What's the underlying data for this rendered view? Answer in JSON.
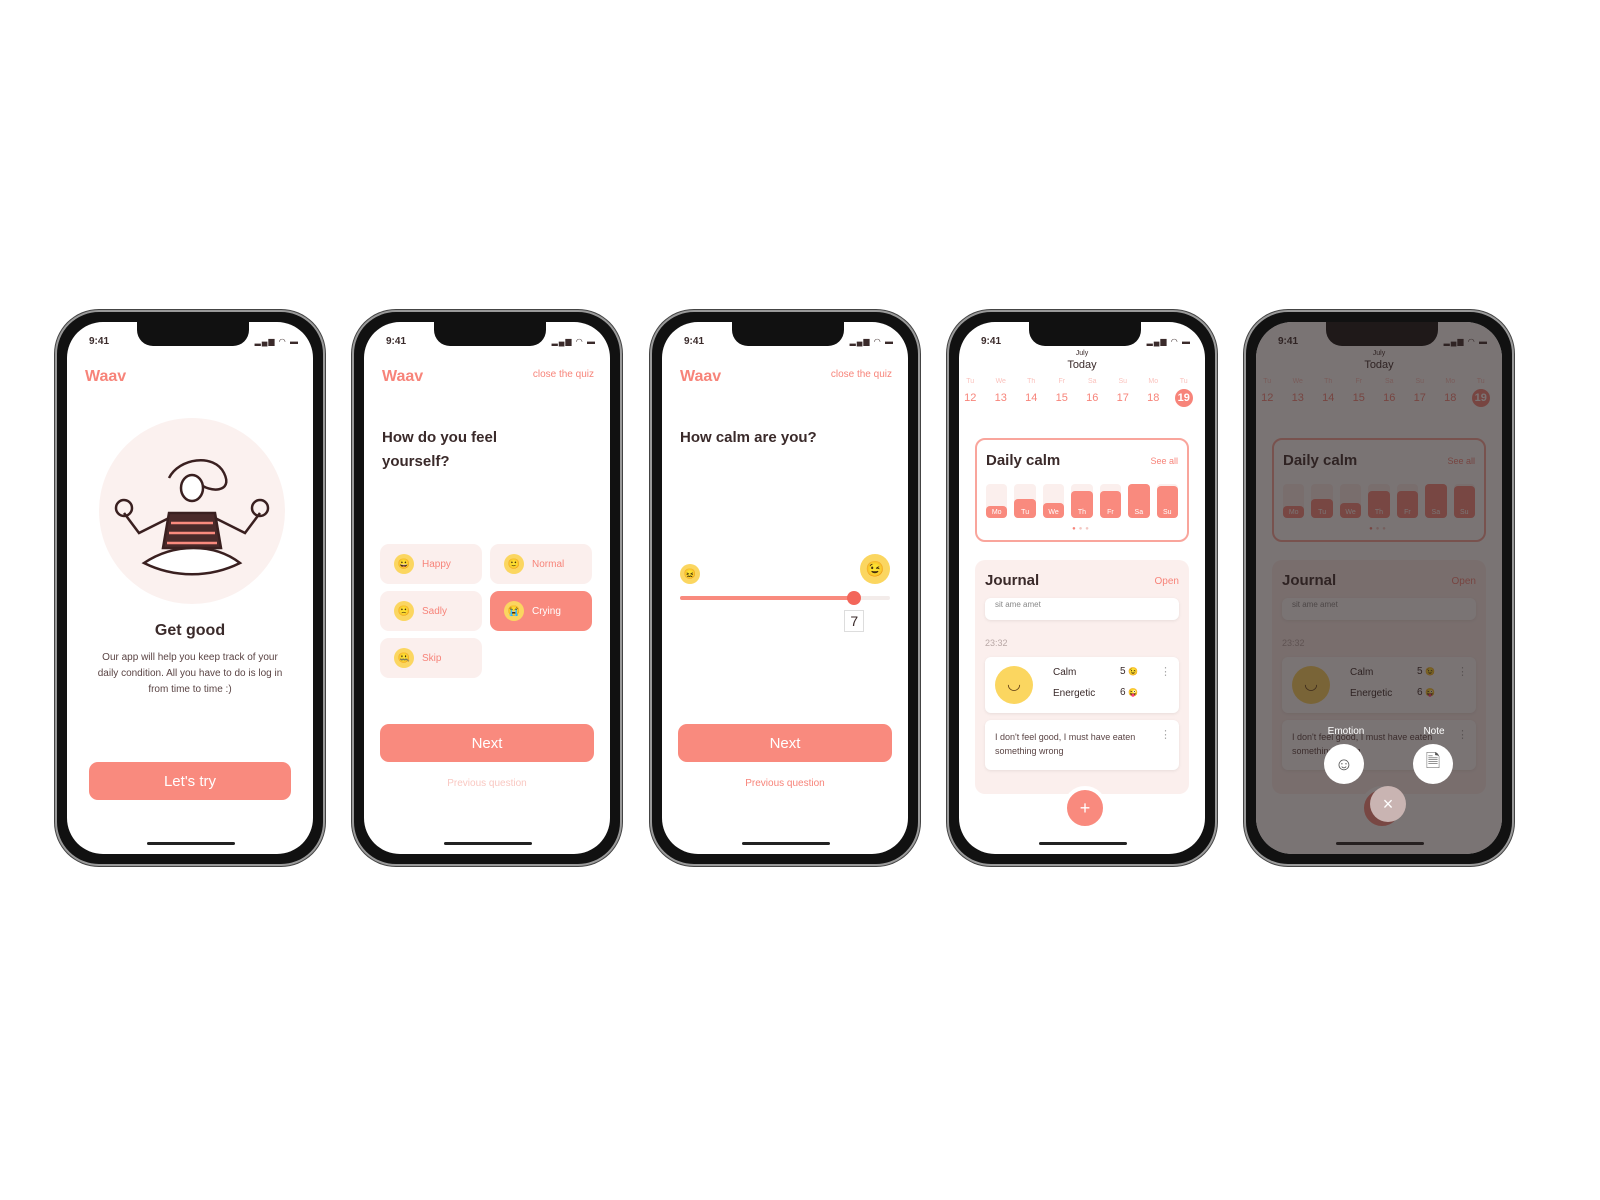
{
  "status": {
    "time": "9:41",
    "signal": "signal-icon",
    "wifi": "wifi-icon",
    "battery": "battery-icon"
  },
  "brand": {
    "logo": "Waav",
    "accent": "#f98a7e",
    "light": "#fbefed"
  },
  "s1": {
    "title": "Get good",
    "body": "Our app will help you keep track of your daily condition. All you have to do is log in from time to time :)",
    "button": "Let's try"
  },
  "s2": {
    "close": "close the quiz",
    "question": "How do you feel yourself?",
    "options": [
      {
        "label": "Happy",
        "emoji": "😀",
        "selected": false
      },
      {
        "label": "Normal",
        "emoji": "🙂",
        "selected": false
      },
      {
        "label": "Sadly",
        "emoji": "🙁",
        "selected": false
      },
      {
        "label": "Crying",
        "emoji": "😭",
        "selected": true
      },
      {
        "label": "Skip",
        "emoji": "🤐",
        "selected": false
      }
    ],
    "next": "Next",
    "previous": "Previous question"
  },
  "s3": {
    "close": "close the quiz",
    "question": "How calm are you?",
    "slider_value": "7",
    "slider_min_emoji": "😖",
    "slider_max_emoji": "😉",
    "slider_fraction": 0.83,
    "next": "Next",
    "previous": "Previous question"
  },
  "s4": {
    "month": "July",
    "today": "Today",
    "days": [
      {
        "w": "Tu",
        "d": "12"
      },
      {
        "w": "We",
        "d": "13"
      },
      {
        "w": "Th",
        "d": "14"
      },
      {
        "w": "Fr",
        "d": "15"
      },
      {
        "w": "Sa",
        "d": "16"
      },
      {
        "w": "Su",
        "d": "17"
      },
      {
        "w": "Mo",
        "d": "18"
      },
      {
        "w": "Tu",
        "d": "19"
      }
    ],
    "daily": {
      "title": "Daily calm",
      "see_all": "See all",
      "bars": [
        {
          "label": "Mo",
          "value": 0.35
        },
        {
          "label": "Tu",
          "value": 0.55
        },
        {
          "label": "We",
          "value": 0.45
        },
        {
          "label": "Th",
          "value": 0.8
        },
        {
          "label": "Fr",
          "value": 0.8
        },
        {
          "label": "Sa",
          "value": 1.0
        },
        {
          "label": "Su",
          "value": 0.95
        }
      ]
    },
    "journal": {
      "title": "Journal",
      "open": "Open",
      "cut_text": "sit ame amet",
      "time": "23:32",
      "rows": [
        {
          "label": "Calm",
          "value": "5",
          "emoji": "😉"
        },
        {
          "label": "Energetic",
          "value": "6",
          "emoji": "😜"
        }
      ],
      "note": "I don't feel good, I must have eaten something wrong"
    },
    "add": "+"
  },
  "s5": {
    "emotion": "Emotion",
    "note": "Note",
    "close": "×"
  }
}
